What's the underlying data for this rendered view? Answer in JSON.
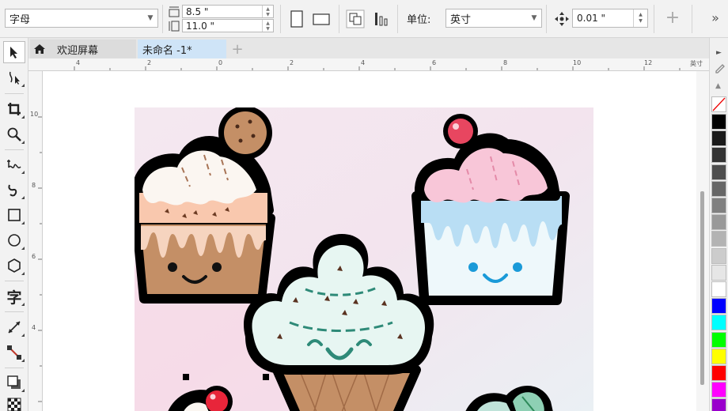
{
  "propbar": {
    "font_combo": "字母",
    "width_value": "8.5 \"",
    "height_value": "11.0 \"",
    "units_label": "单位:",
    "units_value": "英寸",
    "nudge_value": "0.01 \""
  },
  "tabs": {
    "welcome": "欢迎屏幕",
    "document": "未命名 -1*",
    "add": "+"
  },
  "ruler": {
    "unit": "英寸",
    "h_labels": [
      "4",
      "2",
      "0",
      "2",
      "4",
      "6",
      "8",
      "10",
      "12"
    ],
    "v_labels": [
      "10",
      "8",
      "6",
      "4"
    ]
  },
  "toolbox": {
    "tools": [
      "pick-tool",
      "shape-tool",
      "crop-tool",
      "zoom-tool",
      "freehand-tool",
      "artistic-media-tool",
      "rectangle-tool",
      "ellipse-tool",
      "polygon-tool",
      "text-tool",
      "parallel-dimension-tool",
      "connector-tool",
      "drop-shadow-tool",
      "transparency-tool"
    ],
    "text_glyph": "字"
  },
  "palette": {
    "colors": [
      "#000000",
      "#1a1a1a",
      "#333333",
      "#4d4d4d",
      "#666666",
      "#808080",
      "#999999",
      "#b3b3b3",
      "#cccccc",
      "#e6e6e6",
      "#ffffff",
      "#0000ff",
      "#00ffff",
      "#00ff00",
      "#ffff00",
      "#ff0000",
      "#ff00ff",
      "#9900cc"
    ]
  },
  "artwork": {
    "icon": "cupcakes-and-ice-cream-illustration"
  }
}
